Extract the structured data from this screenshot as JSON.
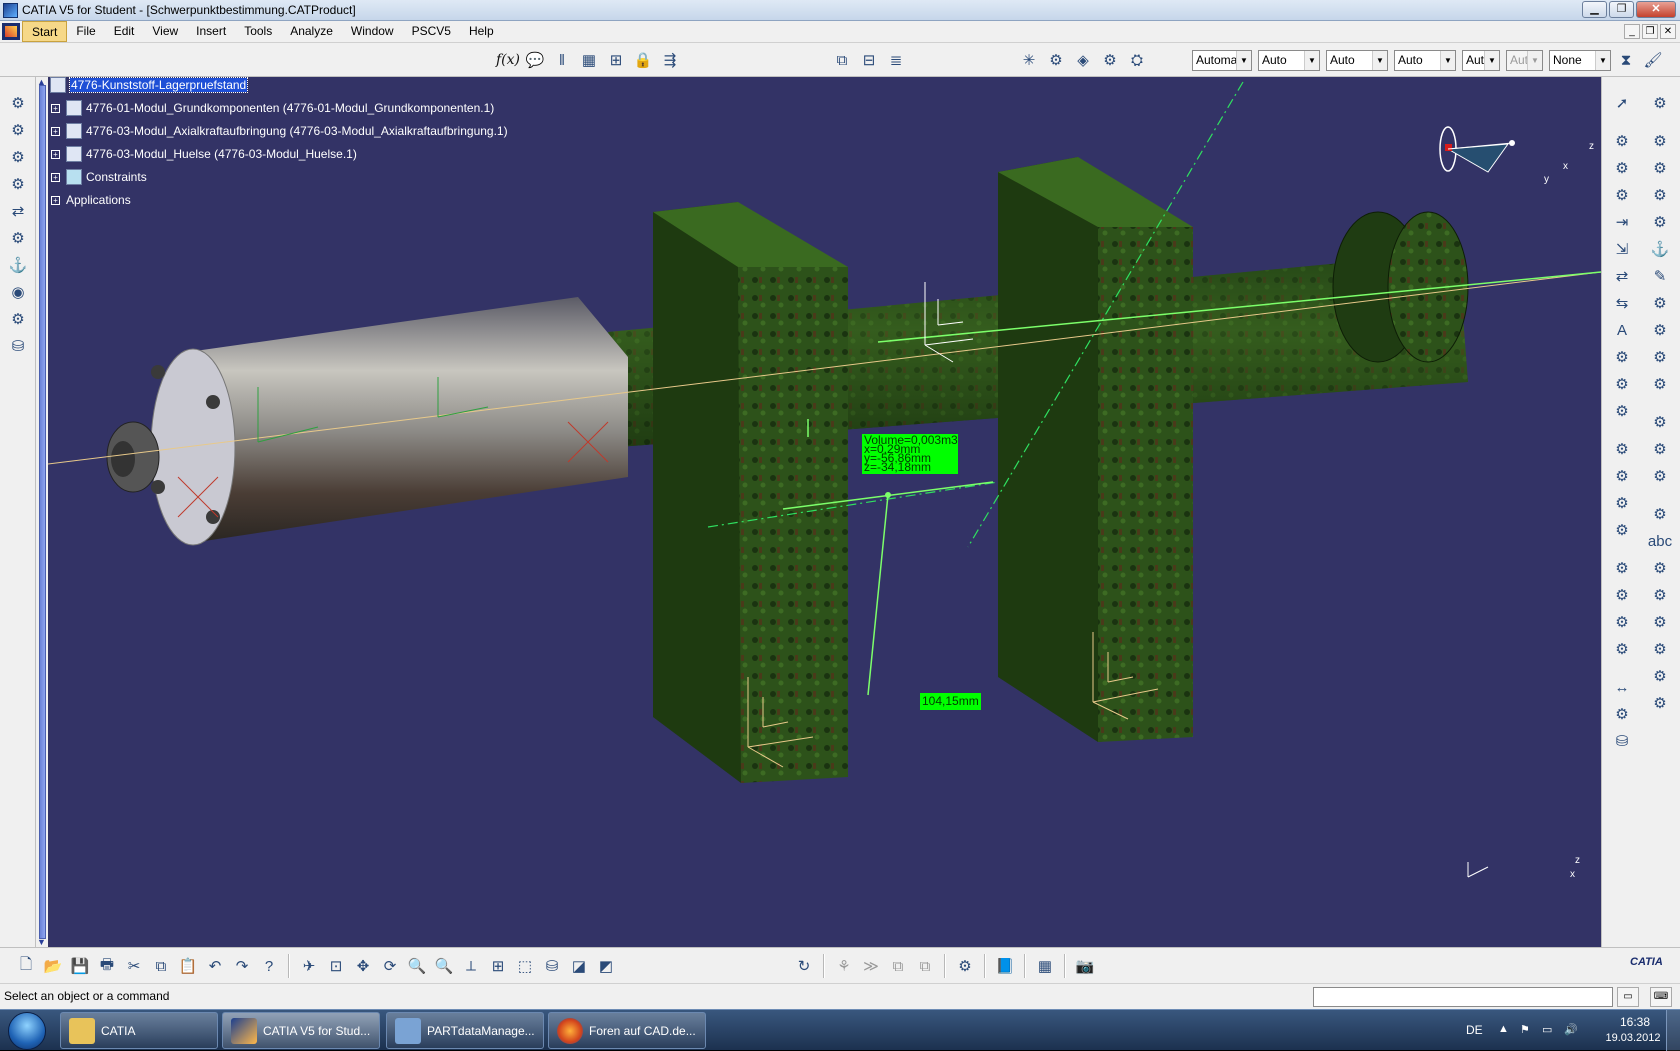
{
  "window": {
    "title": "CATIA V5 for Student - [Schwerpunktbestimmung.CATProduct]"
  },
  "menu": {
    "items": [
      "Start",
      "File",
      "Edit",
      "View",
      "Insert",
      "Tools",
      "Analyze",
      "Window",
      "PSCV5",
      "Help"
    ]
  },
  "toolbar": {
    "dropdowns": [
      "Automa",
      "Auto",
      "Auto",
      "Auto",
      "Aut",
      "Aut",
      "None"
    ]
  },
  "tree": {
    "root": "4776-Kunststoff-Lagerpruefstand",
    "children": [
      "4776-01-Modul_Grundkomponenten (4776-01-Modul_Grundkomponenten.1)",
      "4776-03-Modul_Axialkraftaufbringung (4776-03-Modul_Axialkraftaufbringung.1)",
      "4776-03-Modul_Huelse (4776-03-Modul_Huelse.1)",
      "Constraints",
      "Applications"
    ]
  },
  "measure": {
    "volume": "Volume=0,003m3",
    "x": "x=0,29mm",
    "y": "y=-56,86mm",
    "z": "z=-34,18mm",
    "distance": "104,15mm"
  },
  "axis_labels": {
    "x": "x",
    "y": "y",
    "z": "z"
  },
  "status": {
    "message": "Select an object or a command"
  },
  "brand": {
    "name": "CATIA"
  },
  "taskbar": {
    "tasks": [
      "CATIA",
      "CATIA V5 for Stud...",
      "PARTdataManage...",
      "Foren auf CAD.de..."
    ],
    "language": "DE",
    "time": "16:38",
    "date": "19.03.2012"
  }
}
